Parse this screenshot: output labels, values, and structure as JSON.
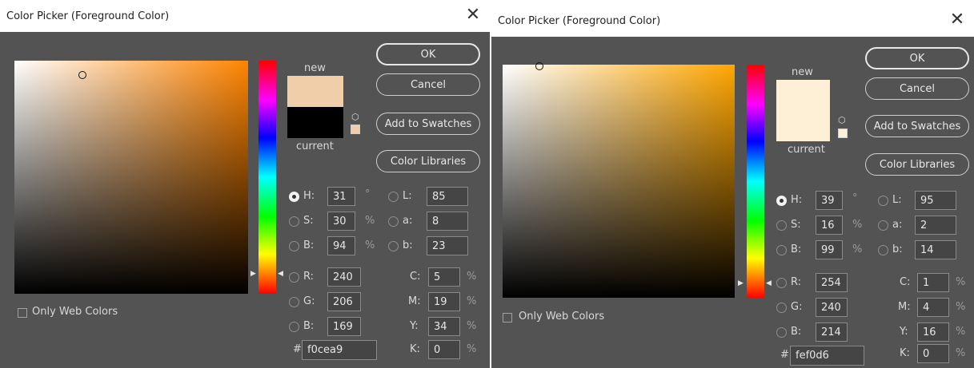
{
  "dialogs": [
    {
      "title": "Color Picker (Foreground Color)",
      "hue_color": "#ff8400",
      "new_color": "#f0cea9",
      "current_color": "#000000",
      "labels": {
        "new": "new",
        "current": "current",
        "only_web": "Only Web Colors"
      },
      "buttons": {
        "ok": "OK",
        "cancel": "Cancel",
        "add_swatches": "Add to Swatches",
        "libraries": "Color Libraries"
      },
      "selected_mode": "H",
      "hsb": [
        {
          "label": "H:",
          "value": "31",
          "unit": "°"
        },
        {
          "label": "S:",
          "value": "30",
          "unit": "%"
        },
        {
          "label": "B:",
          "value": "94",
          "unit": "%"
        }
      ],
      "lab": [
        {
          "label": "L:",
          "value": "85"
        },
        {
          "label": "a:",
          "value": "8"
        },
        {
          "label": "b:",
          "value": "23"
        }
      ],
      "rgb": [
        {
          "label": "R:",
          "value": "240"
        },
        {
          "label": "G:",
          "value": "206"
        },
        {
          "label": "B:",
          "value": "169"
        }
      ],
      "cmyk": [
        {
          "label": "C:",
          "value": "5",
          "unit": "%"
        },
        {
          "label": "M:",
          "value": "19",
          "unit": "%"
        },
        {
          "label": "Y:",
          "value": "34",
          "unit": "%"
        },
        {
          "label": "K:",
          "value": "0",
          "unit": "%"
        }
      ],
      "hex_label": "#",
      "hex": "f0cea9"
    },
    {
      "title": "Color Picker (Foreground Color)",
      "hue_color": "#ffa600",
      "new_color": "#fef0d6",
      "current_color": "#fef0d6",
      "labels": {
        "new": "new",
        "current": "current",
        "only_web": "Only Web Colors"
      },
      "buttons": {
        "ok": "OK",
        "cancel": "Cancel",
        "add_swatches": "Add to Swatches",
        "libraries": "Color Libraries"
      },
      "selected_mode": "H",
      "hsb": [
        {
          "label": "H:",
          "value": "39",
          "unit": "°"
        },
        {
          "label": "S:",
          "value": "16",
          "unit": "%"
        },
        {
          "label": "B:",
          "value": "99",
          "unit": "%"
        }
      ],
      "lab": [
        {
          "label": "L:",
          "value": "95"
        },
        {
          "label": "a:",
          "value": "2"
        },
        {
          "label": "b:",
          "value": "14"
        }
      ],
      "rgb": [
        {
          "label": "R:",
          "value": "254"
        },
        {
          "label": "G:",
          "value": "240"
        },
        {
          "label": "B:",
          "value": "214"
        }
      ],
      "cmyk": [
        {
          "label": "C:",
          "value": "1",
          "unit": "%"
        },
        {
          "label": "M:",
          "value": "4",
          "unit": "%"
        },
        {
          "label": "Y:",
          "value": "16",
          "unit": "%"
        },
        {
          "label": "K:",
          "value": "0",
          "unit": "%"
        }
      ],
      "hex_label": "#",
      "hex": "fef0d6"
    }
  ]
}
